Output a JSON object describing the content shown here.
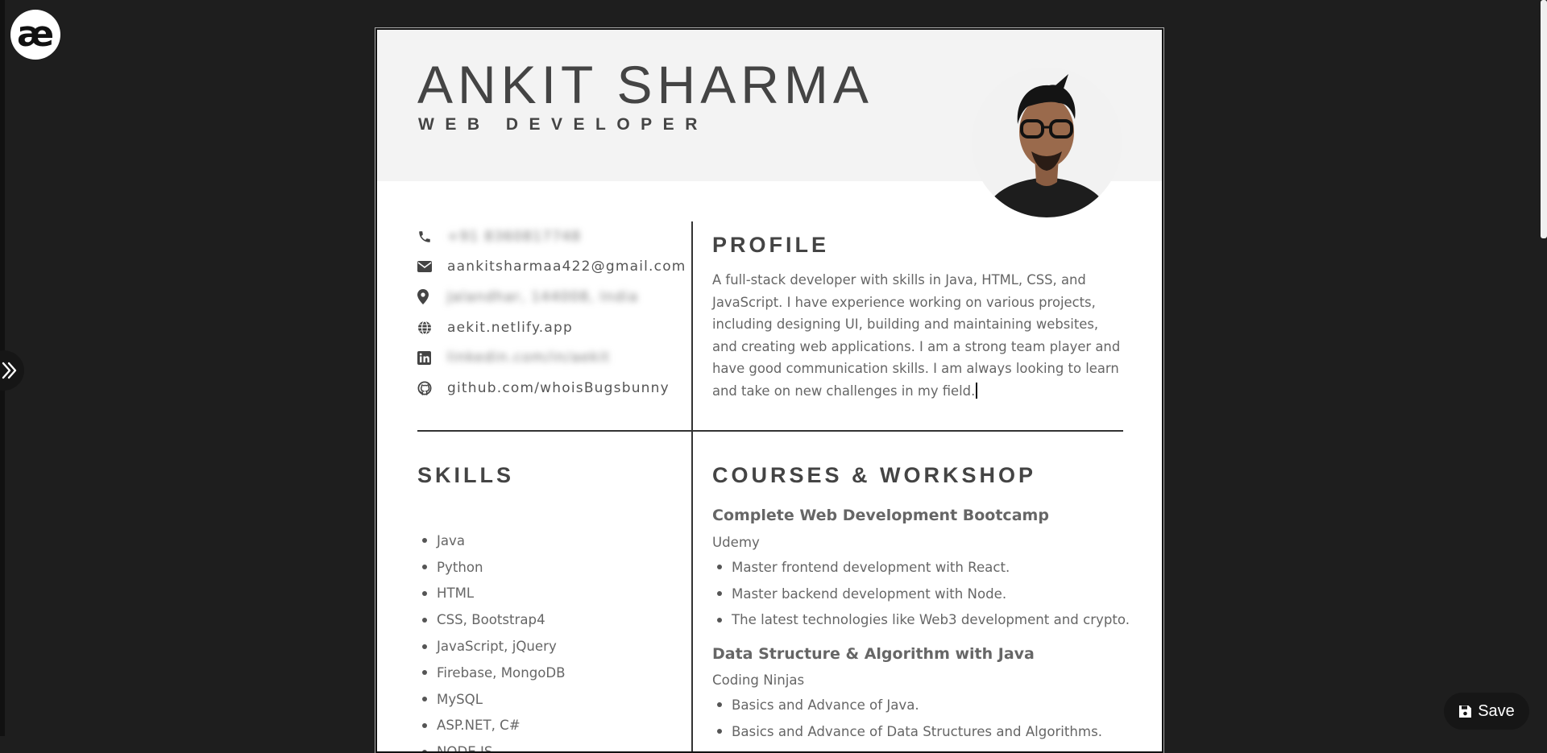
{
  "app": {
    "logo_text": "æ",
    "save_label": "Save"
  },
  "resume": {
    "name": "ANKIT SHARMA",
    "role": "WEB DEVELOPER",
    "contact": {
      "phone": "+91 8360817748",
      "email": "aankitsharmaa422@gmail.com",
      "location": "Jalandhar, 144008, India",
      "website": "aekit.netlify.app",
      "linkedin": "linkedin.com/in/aekit",
      "github": "github.com/whoisBugsbunny"
    },
    "profile": {
      "title": "PROFILE",
      "text": "A full-stack developer with skills in Java, HTML, CSS, and JavaScript. I have experience working on various projects, including designing UI, building and maintaining websites, and creating web applications. I am a strong team player and have good communication skills. I am always looking to learn and take on new challenges in my field."
    },
    "skills": {
      "title": "SKILLS",
      "items": [
        "Java",
        "Python",
        "HTML",
        "CSS, Bootstrap4",
        "JavaScript, jQuery",
        "Firebase, MongoDB",
        "MySQL",
        "ASP.NET, C#",
        "NODE.JS"
      ]
    },
    "courses": {
      "title": "COURSES & WORKSHOP",
      "list": [
        {
          "name": "Complete Web Development Bootcamp",
          "org": "Udemy",
          "points": [
            "Master frontend development with React.",
            "Master backend development with Node.",
            "The latest technologies like Web3 development and crypto."
          ]
        },
        {
          "name": "Data Structure & Algorithm with Java",
          "org": "Coding Ninjas",
          "points": [
            "Basics and Advance of Java.",
            "Basics and Advance of Data Structures and Algorithms."
          ]
        }
      ]
    }
  },
  "icons": {
    "drawer": "double-chevron-right-icon",
    "save": "floppy-disk-icon",
    "phone": "phone-icon",
    "email": "envelope-icon",
    "location": "map-pin-icon",
    "website": "globe-icon",
    "linkedin": "linkedin-icon",
    "github": "github-icon"
  }
}
